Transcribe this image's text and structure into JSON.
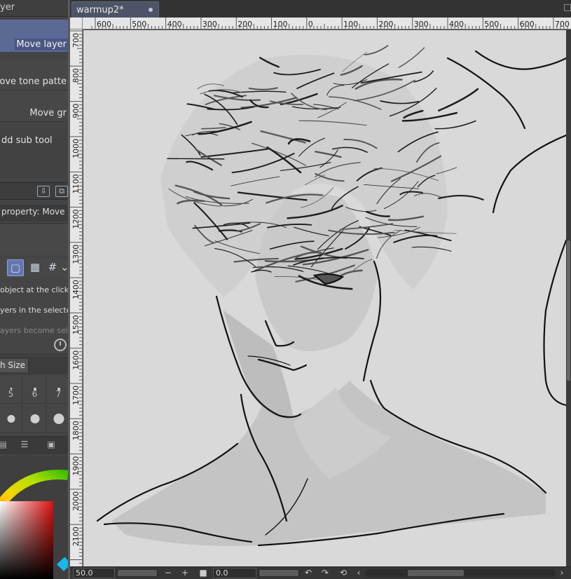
{
  "colors": {
    "panel_bg": "#444444",
    "selected_option_bg": "#5b6a95",
    "tab_bg": "#4e5468",
    "canvas_bg": "#d9d9d9",
    "ruler_bg": "#e6e6e6"
  },
  "tool_property": {
    "header": "yer",
    "options": {
      "move_layer": "Move layer",
      "move_tone": "Move tone patte",
      "move_grid": "Move gr",
      "add_sub_tool": "dd sub tool"
    },
    "property_title": "property: Move la",
    "mode_icons": [
      "layer-mode-icon",
      "checker-icon",
      "grid-icon",
      "chevron-down-icon"
    ],
    "descriptions": [
      "object at the clicked p",
      "yers in the selected ar",
      "ayers become select"
    ]
  },
  "brush_size": {
    "title": "h Size",
    "sizes": [
      "5",
      "6",
      "7"
    ]
  },
  "document": {
    "tab_title": "warmup2*"
  },
  "rulers": {
    "horizontal": [
      "600",
      "500",
      "400",
      "300",
      "200",
      "100",
      "0",
      "100",
      "200",
      "300",
      "400",
      "500",
      "600",
      "700"
    ],
    "vertical": [
      "700",
      "800",
      "900",
      "1000",
      "1100",
      "1200",
      "1300",
      "1400",
      "1500",
      "1600",
      "1700",
      "1800",
      "1900",
      "2000",
      "2100"
    ]
  },
  "status_bar": {
    "zoom": "50.0",
    "rotation": "0.0",
    "minus": "−",
    "plus": "+",
    "undo": "↶",
    "redo": "↷",
    "reset": "⟲",
    "left": "‹",
    "right": "›"
  }
}
